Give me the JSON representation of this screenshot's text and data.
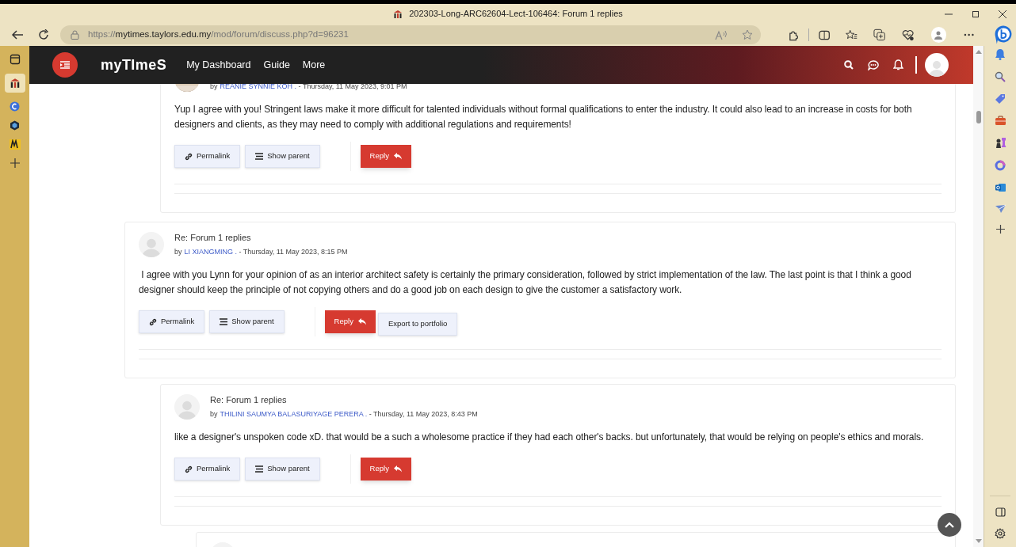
{
  "browser": {
    "tab_title": "202303-Long-ARC62604-Lect-106464: Forum 1 replies",
    "url": {
      "scheme": "https://",
      "host": "mytimes.taylors.edu.my",
      "path": "/mod/forum/discuss.php?d=96231"
    }
  },
  "site": {
    "logo": "myTImeS",
    "nav": [
      "My Dashboard",
      "Guide",
      "More"
    ]
  },
  "thread": [
    {
      "children": [
        {
          "photo_avatar": true,
          "by_label": "by",
          "author": "REANIE SYNNIE KOH .",
          "date": " - Thursday, 11 May 2023, 9:01 PM",
          "message": "Yup I agree with you! Stringent laws make it more difficult for talented individuals without formal qualifications to enter the industry. It could also lead to an increase in costs for both designers and clients, as they may need to comply with additional regulations and requirements!",
          "buttons": [
            {
              "kind": "permalink",
              "label": "Permalink"
            },
            {
              "kind": "parent",
              "label": "Show parent"
            },
            {
              "kind": "reply",
              "label": "Reply"
            }
          ]
        }
      ]
    },
    {
      "photo_avatar": false,
      "subject": "Re: Forum 1 replies",
      "by_label": "by",
      "author": "LI XIANGMING .",
      "date": " - Thursday, 11 May 2023, 8:15 PM",
      "message": " I agree with you Lynn for your opinion of as an interior architect safety is certainly the primary consideration, followed by strict implementation of the law. The last point is that I think a good designer should keep the principle of not copying others and do a good job on each design to give the customer a satisfactory work.",
      "buttons": [
        {
          "kind": "permalink",
          "label": "Permalink"
        },
        {
          "kind": "parent",
          "label": "Show parent"
        },
        {
          "kind": "reply",
          "label": "Reply"
        },
        {
          "kind": "export",
          "label": "Export to portfolio"
        }
      ],
      "children": [
        {
          "photo_avatar": false,
          "subject": "Re: Forum 1 replies",
          "by_label": "by",
          "author": "THILINI SAUMYA BALASURIYAGE PERERA .",
          "date": " - Thursday, 11 May 2023, 8:43 PM",
          "message": "like a designer's unspoken code xD. that would be a such a wholesome practice if they had each other's backs. but unfortunately, that would be relying on people's ethics and morals.",
          "buttons": [
            {
              "kind": "permalink",
              "label": "Permalink"
            },
            {
              "kind": "parent",
              "label": "Show parent"
            },
            {
              "kind": "reply",
              "label": "Reply"
            }
          ],
          "has_more_replies": true
        }
      ]
    }
  ]
}
